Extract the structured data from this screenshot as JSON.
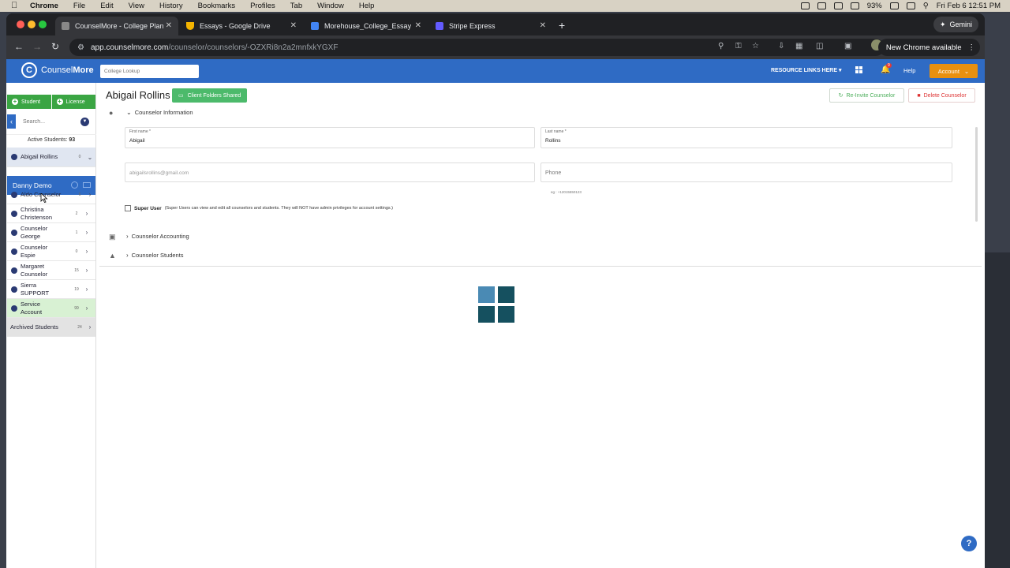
{
  "menubar": {
    "app": "Chrome",
    "items": [
      "File",
      "Edit",
      "View",
      "History",
      "Bookmarks",
      "Profiles",
      "Tab",
      "Window",
      "Help"
    ],
    "battery": "93%",
    "datetime": "Fri Feb 6  12:51 PM"
  },
  "browser": {
    "tabs": [
      {
        "title": "CounselMore - College Planni",
        "icon_color": "#888888"
      },
      {
        "title": "Essays - Google Drive",
        "icon_color": "#f4b400"
      },
      {
        "title": "Morehouse_College_Essays",
        "icon_color": "#4285f4"
      },
      {
        "title": "Stripe Express",
        "icon_color": "#635bff"
      }
    ],
    "gemini_label": "Gemini",
    "url_host": "app.counselmore.com",
    "url_path": "/counselor/counselors/-OZXRi8n2a2mnfxkYGXF",
    "update_label": "New Chrome available"
  },
  "app": {
    "brand_light": "Counsel",
    "brand_bold": "More",
    "college_lookup_placeholder": "College Lookup",
    "resource_links": "RESOURCE LINKS HERE",
    "help": "Help",
    "account": "Account",
    "notifications": "9",
    "colors": {
      "primary": "#2f6bc4",
      "green": "#3aa543",
      "orange": "#e8900f"
    }
  },
  "sidebar": {
    "student_btn": "Student",
    "license_btn": "License",
    "search_placeholder": "Search...",
    "active_label": "Active Students:",
    "active_count": "93",
    "selected": {
      "name": "Abigail Rollins",
      "count": "0"
    },
    "student": "Danny Demo",
    "counselors": [
      {
        "name": "Aldo Counselor",
        "count": "6"
      },
      {
        "name": "Christina Christenson",
        "count": "2"
      },
      {
        "name": "Counselor George",
        "count": "1"
      },
      {
        "name": "Counselor Espie",
        "count": "0"
      },
      {
        "name": "Margaret Counselor",
        "count": "15"
      },
      {
        "name": "Sierra SUPPORT",
        "count": "19"
      },
      {
        "name": "Service Account",
        "count": "99"
      }
    ],
    "archived": {
      "name": "Archived Students",
      "count": "24"
    }
  },
  "main": {
    "title": "Abigail Rollins",
    "client_folders": "Client Folders Shared",
    "reinvite": "Re-Invite Counselor",
    "delete": "Delete Counselor",
    "sections": {
      "info": "Counselor Information",
      "accounting": "Counselor Accounting",
      "students": "Counselor Students"
    },
    "form": {
      "first_label": "First name *",
      "first_value": "Abigail",
      "last_label": "Last name *",
      "last_value": "Rollins",
      "email": "abigailsrollins@gmail.com",
      "phone_placeholder": "Phone",
      "phone_hint": "eg : +12015550123",
      "super_user_label": "Super User",
      "super_user_note": "(Super Users can view and edit all counselors and students. They will NOT have admin privileges for account settings.)"
    },
    "loader_colors": [
      "#4a8ab4",
      "#15505f",
      "#15505f",
      "#15505f"
    ]
  }
}
